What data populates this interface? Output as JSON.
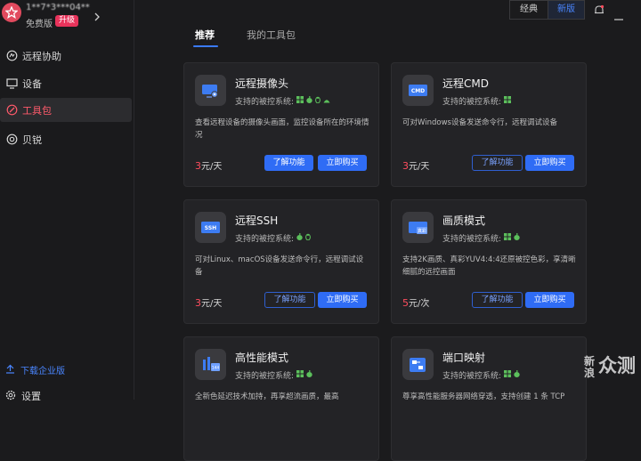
{
  "profile": {
    "user_name": "1**7*3***04**",
    "edition": "免费版",
    "upgrade_label": "升级"
  },
  "sidebar": {
    "items": [
      {
        "label": "远程协助",
        "icon": "remote-assist-icon"
      },
      {
        "label": "设备",
        "icon": "monitor-icon"
      },
      {
        "label": "工具包",
        "icon": "toolkit-icon",
        "active": true
      },
      {
        "label": "贝锐",
        "icon": "oray-icon"
      }
    ],
    "download_label": "下载企业版",
    "settings_label": "设置"
  },
  "topbar": {
    "classic_label": "经典",
    "new_label": "新版"
  },
  "tabs": [
    {
      "label": "推荐",
      "active": true
    },
    {
      "label": "我的工具包",
      "active": false
    }
  ],
  "cards": [
    {
      "title": "远程摄像头",
      "systems_label": "支持的被控系统:",
      "desc": "查看远程设备的摄像头画面，监控设备所在的环境情况",
      "price_num": "3",
      "price_unit": "元/天",
      "learn_label": "了解功能",
      "buy_label": "立即购买",
      "icon": "camera-icon"
    },
    {
      "title": "远程CMD",
      "systems_label": "支持的被控系统:",
      "desc": "可对Windows设备发送命令行，远程调试设备",
      "price_num": "3",
      "price_unit": "元/天",
      "learn_label": "了解功能",
      "buy_label": "立即购买",
      "icon": "cmd-icon"
    },
    {
      "title": "远程SSH",
      "systems_label": "支持的被控系统:",
      "desc": "可对Linux、macOS设备发送命令行，远程调试设备",
      "price_num": "3",
      "price_unit": "元/天",
      "learn_label": "了解功能",
      "buy_label": "立即购买",
      "icon": "ssh-icon"
    },
    {
      "title": "画质模式",
      "systems_label": "支持的被控系统:",
      "desc": "支持2K画质、真彩YUV4:4:4还原被控色彩，享清晰细腻的远控画面",
      "price_num": "5",
      "price_unit": "元/次",
      "learn_label": "了解功能",
      "buy_label": "立即购买",
      "icon": "true-color-icon"
    },
    {
      "title": "高性能模式",
      "systems_label": "支持的被控系统:",
      "desc": "全新色延迟技术加持，再享超流画质，最高",
      "icon": "performance-icon"
    },
    {
      "title": "端口映射",
      "systems_label": "支持的被控系统:",
      "desc": "尊享高性能服务器网络穿透，支持创建 1 条 TCP",
      "icon": "port-mapping-icon"
    }
  ],
  "watermark": {
    "line1": "新",
    "line2": "浪",
    "rest": "众测"
  },
  "colors": {
    "accent": "#2f6cf5",
    "active_nav": "#ff5a6b",
    "price": "#ff4d5e",
    "upgrade": "#e8335b"
  }
}
